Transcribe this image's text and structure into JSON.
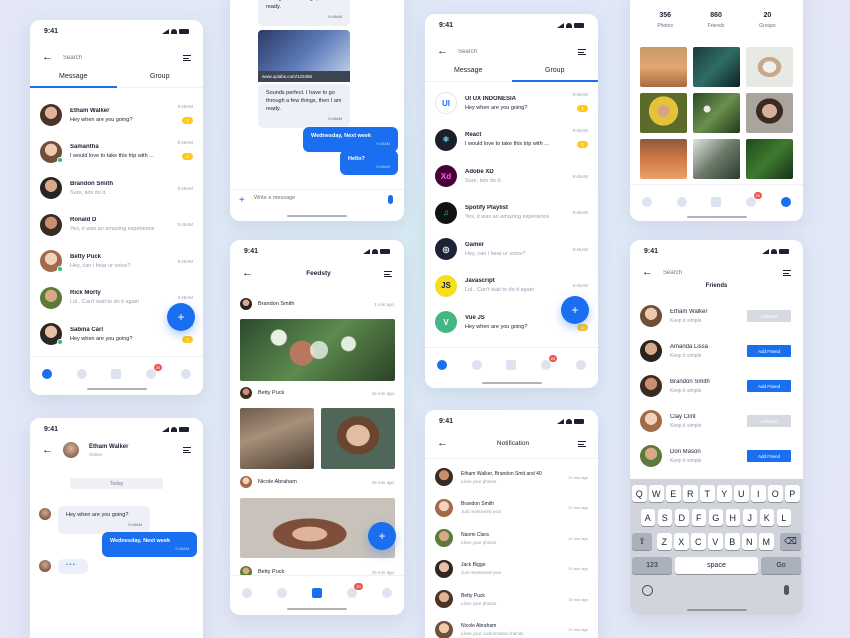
{
  "colors": {
    "accent": "#1a6ff0",
    "badge_yellow": "#ffc81f",
    "notify_red": "#f2554f",
    "online": "#27c27a"
  },
  "status_time": "9:41",
  "search_placeholder": "Search",
  "tabs": {
    "message": "Message",
    "group": "Group"
  },
  "messages_screen": {
    "rows": [
      {
        "name": "Etham Walker",
        "msg": "Hey when are you going?",
        "time": "9:45AM",
        "badge": "1"
      },
      {
        "name": "Samantha",
        "msg": "I would love to take this trip with ...",
        "time": "9:45AM",
        "badge": "1"
      },
      {
        "name": "Brandon Smith",
        "msg": "Sure, lets do it.",
        "time": "9:45AM",
        "badge": ""
      },
      {
        "name": "Ronald D",
        "msg": "Yes, it was an amazing experience",
        "time": "9:45AM",
        "badge": ""
      },
      {
        "name": "Betty Puck",
        "msg": "Hey, can i hear ur voice?",
        "time": "9:45AM",
        "badge": ""
      },
      {
        "name": "Rick Morty",
        "msg": "Lol.. Can't wait to do it again",
        "time": "9:45AM",
        "badge": ""
      },
      {
        "name": "Sabina Carl",
        "msg": "Hey when are you going?",
        "time": "9:45AM",
        "badge": "1"
      }
    ],
    "nav_badge": "20"
  },
  "chat_top": {
    "bubble1": "through a few things, then I am ready.",
    "time1": "9:45AM",
    "link": "www.uplabs.com/123456",
    "bubble2": "Sounds perfect. I have to go through a few things, then I am ready.",
    "time2": "9:45AM",
    "out1": "Wednesday, Next week",
    "out1_time": "9:45AM",
    "out2": "Hello?",
    "out2_time": "9:45AM",
    "input_placeholder": "Write a message"
  },
  "chat_bottom": {
    "name": "Etham Walker",
    "status": "Online",
    "day": "Today",
    "in1": "Hey when are you going?",
    "in1_time": "9:45AM",
    "out1": "Wednesday, Next week",
    "out1_time": "9:45AM",
    "typing": "• • •"
  },
  "feed": {
    "title": "Feedsty",
    "posts": [
      {
        "name": "Brandon Smith",
        "time": "1 min ago"
      },
      {
        "name": "Betty Puck",
        "time": "15 min ago"
      },
      {
        "name": "Nicole Abraham",
        "time": "15 min ago"
      },
      {
        "name": "Betty Puck",
        "time": "15 min ago"
      }
    ],
    "nav_badge": "20"
  },
  "groups_screen": {
    "rows": [
      {
        "name": "UI UX INDONESIA",
        "msg": "Hey when are you going?",
        "time": "9:45AM",
        "badge": "1",
        "icon": "UI"
      },
      {
        "name": "React",
        "msg": "I would love to take this trip with ...",
        "time": "9:45AM",
        "badge": "1",
        "icon": "⚛"
      },
      {
        "name": "Adobe XD",
        "msg": "Sure, lets do it.",
        "time": "9:45AM",
        "badge": "",
        "icon": "Xd"
      },
      {
        "name": "Spotify Playlist",
        "msg": "Yes, it was an amazing experience",
        "time": "9:45AM",
        "badge": "",
        "icon": "♫"
      },
      {
        "name": "Gamer",
        "msg": "Hey, can i hear ur voice?",
        "time": "9:45AM",
        "badge": "",
        "icon": "◎"
      },
      {
        "name": "Javascript",
        "msg": "Lol.. Can't wait to do it again",
        "time": "9:45AM",
        "badge": "",
        "icon": "JS"
      },
      {
        "name": "Vue JS",
        "msg": "Hey when are you going?",
        "time": "9:45AM",
        "badge": "1",
        "icon": "V"
      }
    ],
    "nav_badge": "20"
  },
  "notifications": {
    "title": "Notification",
    "rows": [
      {
        "who": "Etham Walker, Brandon Smit and 40",
        "what": "Likes your photos",
        "time": "10 min ago"
      },
      {
        "who": "Brandon Smith",
        "what": "Just mentioned you!",
        "time": "10 min ago"
      },
      {
        "who": "Naomi Clara",
        "what": "Likes your photos",
        "time": "10 min ago"
      },
      {
        "who": "Jack Bigge",
        "what": "Just mentioned you!",
        "time": "10 min ago"
      },
      {
        "who": "Betty Puck",
        "what": "Likes your photos",
        "time": "10 min ago"
      },
      {
        "who": "Nicole Abraham",
        "what": "Likes your conformation friends",
        "time": "10 min ago"
      }
    ]
  },
  "profile": {
    "stats": [
      {
        "value": "356",
        "label": "Photos"
      },
      {
        "value": "860",
        "label": "Friends"
      },
      {
        "value": "20",
        "label": "Groups"
      }
    ],
    "nav_badge": "20"
  },
  "friends": {
    "title": "Friends",
    "rows": [
      {
        "name": "Etham Walker",
        "sub": "Keep it simple",
        "action": "Unfriend",
        "unfriend": true
      },
      {
        "name": "Amanda Lissa",
        "sub": "Keep it simple",
        "action": "Add Friend",
        "unfriend": false
      },
      {
        "name": "Brandon Smith",
        "sub": "Keep it simple",
        "action": "Add Friend",
        "unfriend": false
      },
      {
        "name": "Clay Clint",
        "sub": "Keep it simple",
        "action": "Unfriend",
        "unfriend": true
      },
      {
        "name": "Dori Mason",
        "sub": "Keep it simple",
        "action": "Add Friend",
        "unfriend": false
      }
    ]
  },
  "keyboard": {
    "row1": [
      "Q",
      "W",
      "E",
      "R",
      "T",
      "Y",
      "U",
      "I",
      "O",
      "P"
    ],
    "row2": [
      "A",
      "S",
      "D",
      "F",
      "G",
      "H",
      "J",
      "K",
      "L"
    ],
    "row3": [
      "Z",
      "X",
      "C",
      "V",
      "B",
      "N",
      "M"
    ],
    "num": "123",
    "space": "space",
    "go": "Go"
  }
}
